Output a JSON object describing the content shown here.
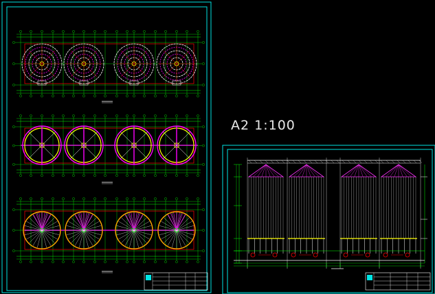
{
  "scale_label": "A2 1:100",
  "colors": {
    "background": "#000000",
    "frame": "#00e5e5",
    "grid": "#00ff00",
    "dims": "#00ff00",
    "beam": "#ff0000",
    "ring": "#ffff00",
    "radial": "#ff00ff",
    "white": "#ffffff",
    "silo_roof": "#ff33ff",
    "elevation_lines": "#c0c0c0",
    "footing": "#ffff00"
  },
  "sheet_left": {
    "plans": [
      {
        "kind": "roof-plan",
        "silos": 4
      },
      {
        "kind": "ring-beam-plan",
        "silos": 4
      },
      {
        "kind": "foundation-plan",
        "silos": 4
      }
    ],
    "title_block": "title-block"
  },
  "sheet_right": {
    "elevation": {
      "silos": 4,
      "kind": "silo-elevation"
    },
    "title_block": "title-block"
  }
}
